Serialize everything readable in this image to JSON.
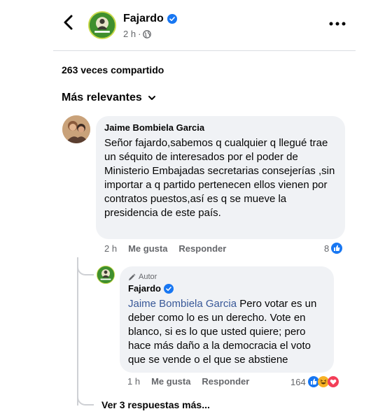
{
  "header": {
    "page_name": "Fajardo",
    "time": "2 h",
    "separator": "·"
  },
  "post": {
    "share_count": "263 veces compartido"
  },
  "sort": {
    "label": "Más relevantes"
  },
  "comment": {
    "author": "Jaime Bombiela Garcia",
    "text": "Señor fajardo,sabemos q cualquier q llegué trae un séquito de interesados por el poder de Ministerio Embajadas secretarias consejerías ,sin importar a q partido pertenecen ellos vienen por contratos puestos,así es q se mueve la presidencia de este país.",
    "time": "2 h",
    "like_label": "Me gusta",
    "reply_label": "Responder",
    "reaction_count": "8"
  },
  "reply": {
    "badge": "Autor",
    "author": "Fajardo",
    "mention": "Jaime Bombiela Garcia",
    "text": " Pero votar es un deber como lo es un derecho. Vote en blanco, si es lo que usted quiere; pero hace más daño a la democracia el voto que se vende o el que se abstiene",
    "time": "1 h",
    "like_label": "Me gusta",
    "reply_label": "Responder",
    "reaction_count": "164"
  },
  "more_replies": {
    "label": "Ver 3 respuestas más..."
  },
  "colors": {
    "verified": "#1877f2",
    "like": "#1877f2",
    "haha": "#f7b125",
    "love": "#f33e58",
    "mention": "#385898",
    "bubble": "#f0f2f5",
    "avatar_green": "#3f8f2e"
  },
  "icons": {
    "back": "chevron-left-icon",
    "verified": "verified-badge-icon",
    "privacy": "globe-icon",
    "more": "more-dots-icon",
    "sort": "chevron-down-icon",
    "author_badge": "pen-icon"
  }
}
